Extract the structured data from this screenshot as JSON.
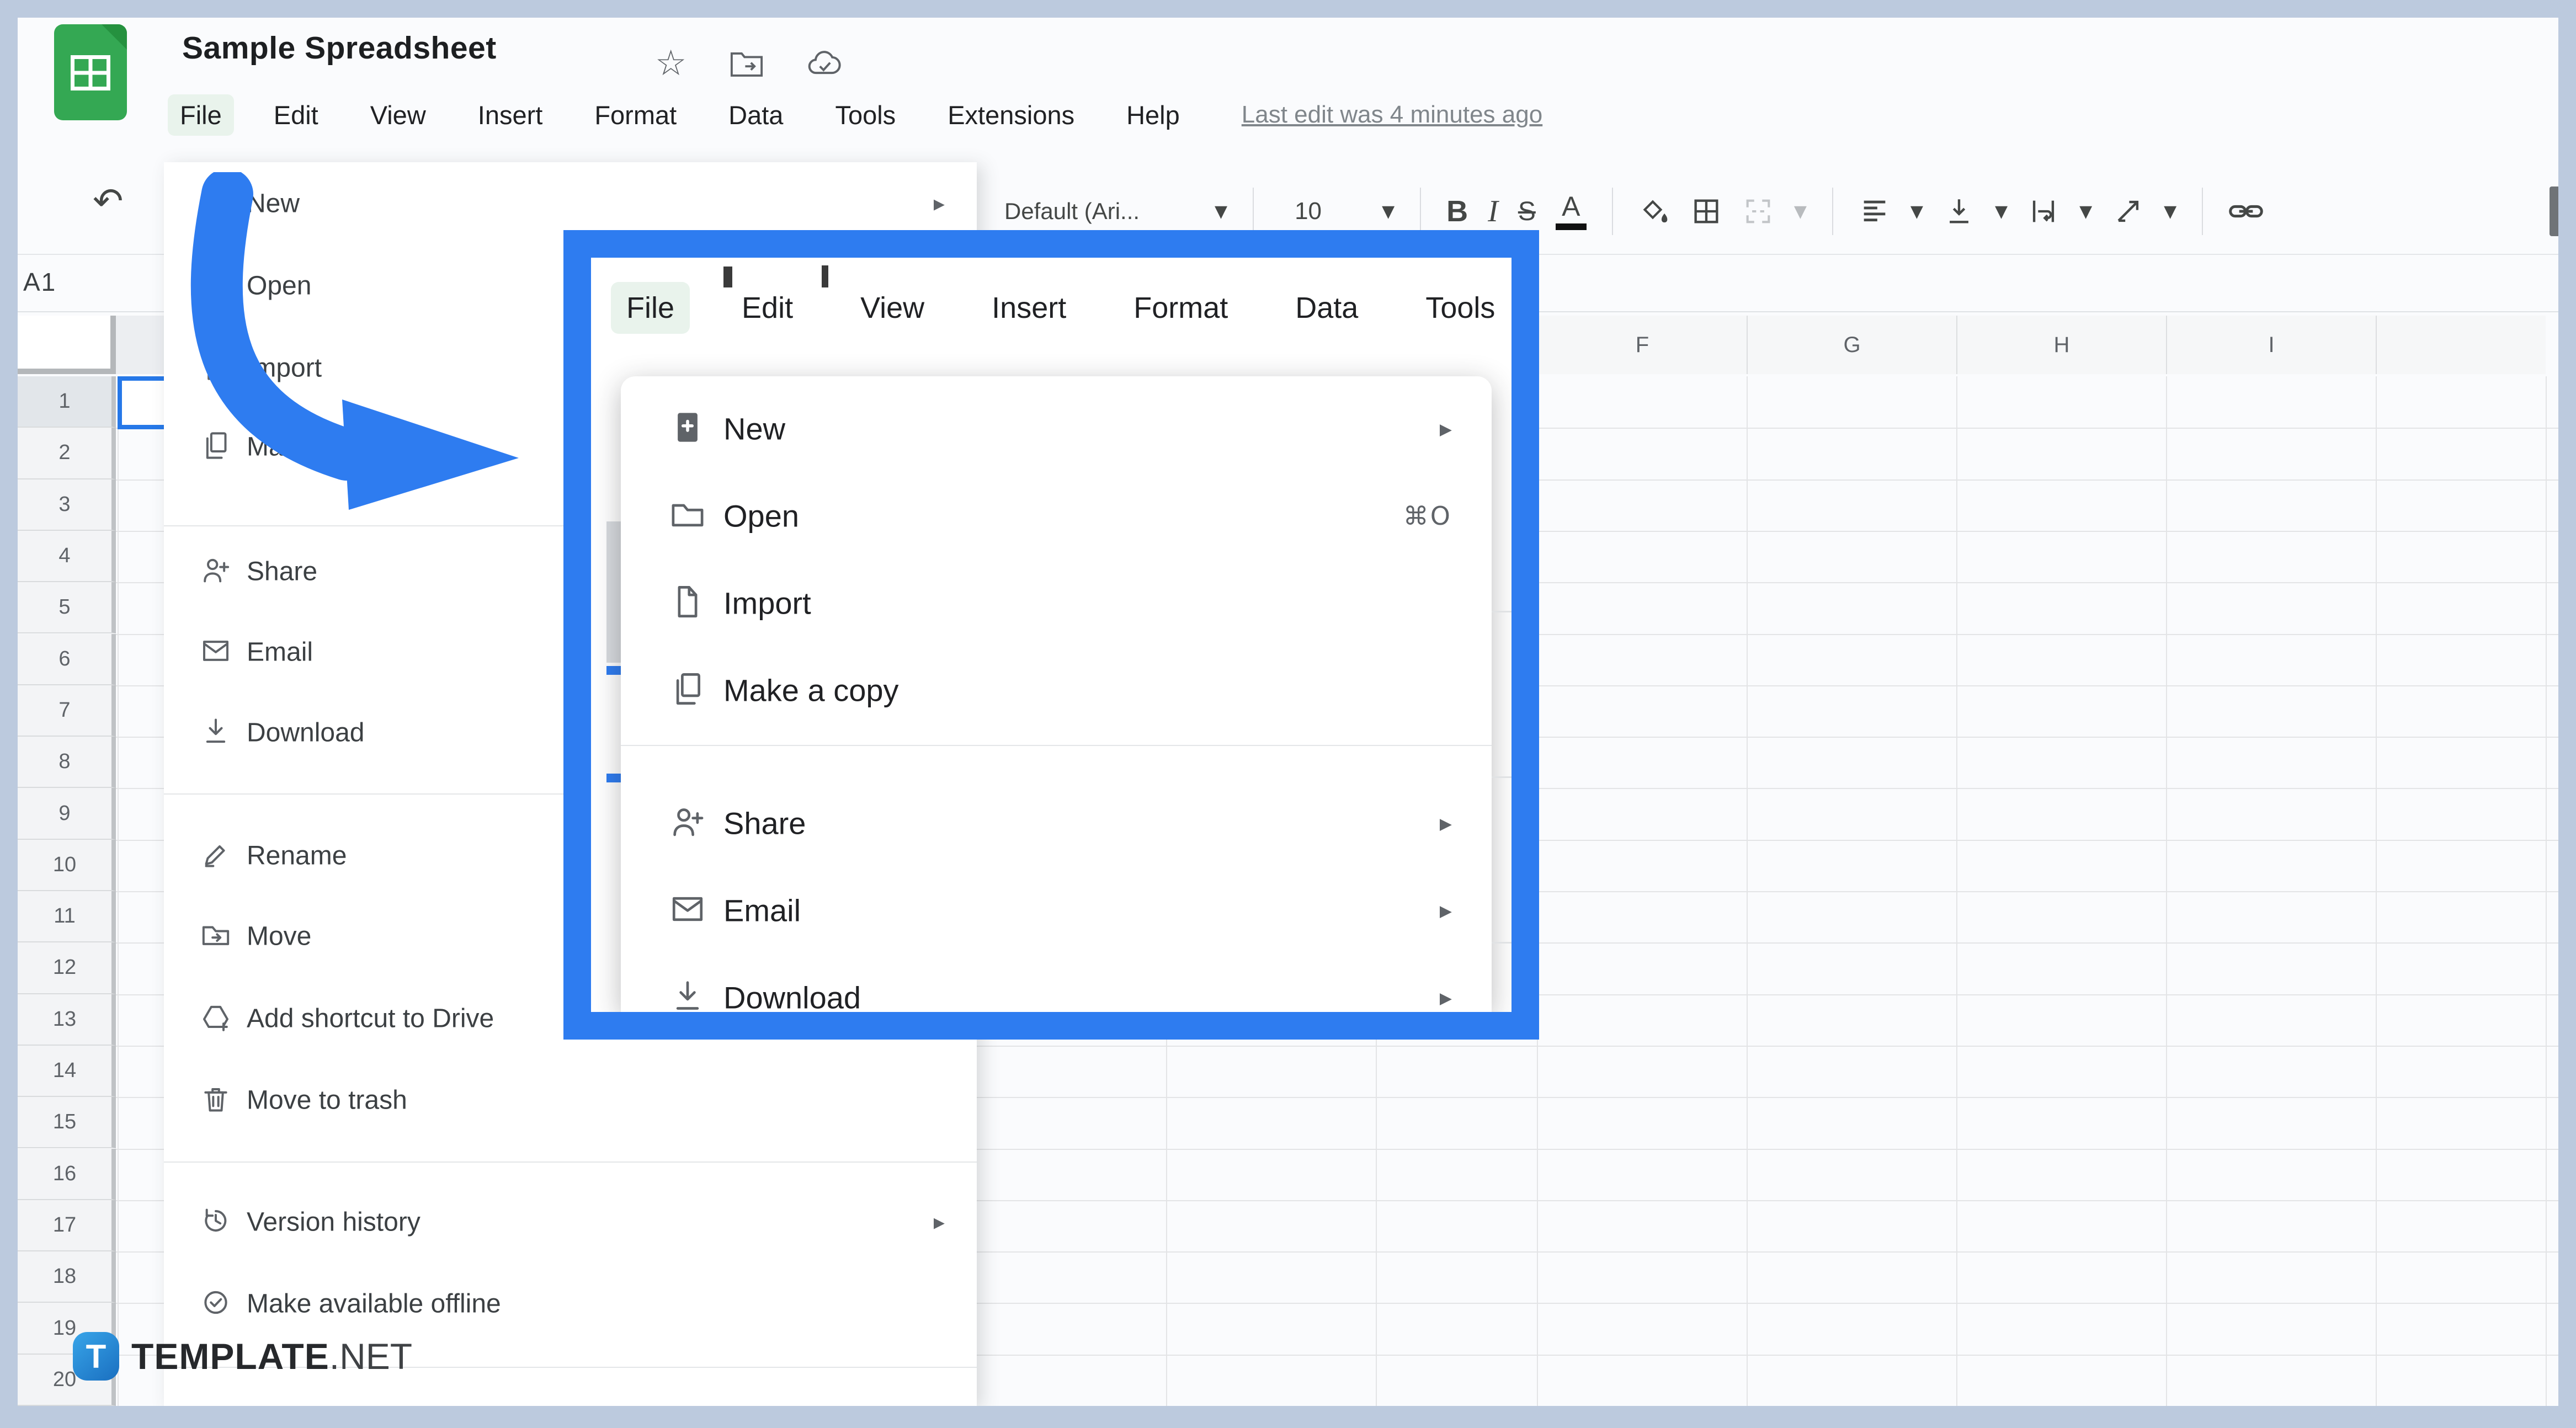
{
  "window": {
    "title": "Sample Spreadsheet"
  },
  "title_icons": [
    {
      "name": "star-icon"
    },
    {
      "name": "move-to-folder-icon"
    },
    {
      "name": "cloud-saved-icon"
    }
  ],
  "menubar": {
    "items": [
      "File",
      "Edit",
      "View",
      "Insert",
      "Format",
      "Data",
      "Tools",
      "Extensions",
      "Help"
    ],
    "active_item": "File",
    "last_edit": "Last edit was 4 minutes ago"
  },
  "toolbar": {
    "font_family": "Default (Ari...",
    "font_size": "10",
    "bold_label": "B",
    "italic_label": "I",
    "strikethrough_label": "S",
    "text_color_label": "A"
  },
  "name_box": {
    "value": "A1"
  },
  "grid": {
    "columns": [
      "F",
      "G",
      "H",
      "I"
    ],
    "rows": [
      "1",
      "2",
      "3",
      "4",
      "5",
      "6",
      "7",
      "8",
      "9",
      "10",
      "11",
      "12",
      "13",
      "14",
      "15",
      "16",
      "17",
      "18",
      "19",
      "20"
    ],
    "selected_cell": "A1"
  },
  "file_menu": {
    "items": [
      {
        "label": "New",
        "icon": "",
        "submenu": true
      },
      {
        "label": "Open",
        "icon": "folder"
      },
      {
        "label": "Import",
        "icon": "file"
      },
      {
        "label": "Make a copy",
        "icon": "copy"
      },
      {
        "type": "separator"
      },
      {
        "label": "Share",
        "icon": "person-add"
      },
      {
        "label": "Email",
        "icon": "mail"
      },
      {
        "label": "Download",
        "icon": "download"
      },
      {
        "type": "separator"
      },
      {
        "label": "Rename",
        "icon": "pencil"
      },
      {
        "label": "Move",
        "icon": "folder-move"
      },
      {
        "label": "Add shortcut to Drive",
        "icon": "drive-add"
      },
      {
        "label": "Move to trash",
        "icon": "trash"
      },
      {
        "type": "separator"
      },
      {
        "label": "Version history",
        "icon": "history",
        "submenu": true
      },
      {
        "label": "Make available offline",
        "icon": "offline-check"
      },
      {
        "type": "separator"
      }
    ]
  },
  "inset": {
    "menu_items": [
      "File",
      "Edit",
      "View",
      "Insert",
      "Format",
      "Data",
      "Tools"
    ],
    "active_item": "File",
    "items": [
      {
        "label": "New",
        "icon": "new-file-filled",
        "submenu": true
      },
      {
        "label": "Open",
        "icon": "folder",
        "shortcut": "⌘O"
      },
      {
        "label": "Import",
        "icon": "file"
      },
      {
        "label": "Make a copy",
        "icon": "copy"
      },
      {
        "type": "separator"
      },
      {
        "label": "Share",
        "icon": "person-add",
        "submenu": true
      },
      {
        "label": "Email",
        "icon": "mail",
        "submenu": true
      },
      {
        "label": "Download",
        "icon": "download",
        "submenu": true
      }
    ]
  },
  "watermark": {
    "badge": "T",
    "bold": "TEMPLATE",
    "light": ".NET"
  },
  "colors": {
    "accent_blue": "#2e7cf0",
    "sheets_green": "#34a853",
    "frame": "#bccade",
    "selection_blue": "#2678e8"
  }
}
